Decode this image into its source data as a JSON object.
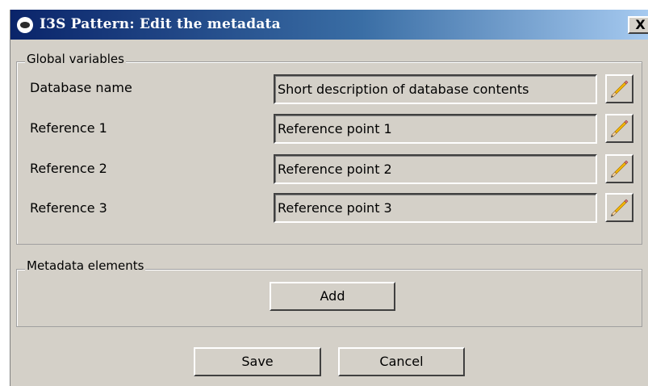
{
  "window": {
    "title": "I3S Pattern: Edit the metadata",
    "app_icon": "eye-icon",
    "close_label": "X"
  },
  "global_variables": {
    "legend": "Global variables",
    "rows": [
      {
        "label": "Database name",
        "value": "Short description of database contents",
        "edit_icon": "pencil-icon"
      },
      {
        "label": "Reference 1",
        "value": "Reference point 1",
        "edit_icon": "pencil-icon"
      },
      {
        "label": "Reference 2",
        "value": "Reference point 2",
        "edit_icon": "pencil-icon"
      },
      {
        "label": "Reference 3",
        "value": "Reference point 3",
        "edit_icon": "pencil-icon"
      }
    ]
  },
  "metadata_elements": {
    "legend": "Metadata elements",
    "add_label": "Add"
  },
  "footer": {
    "save_label": "Save",
    "cancel_label": "Cancel"
  },
  "colors": {
    "title_bar_start": "#0a246a",
    "title_bar_end": "#a6caf0",
    "window_background": "#d4d0c8"
  }
}
